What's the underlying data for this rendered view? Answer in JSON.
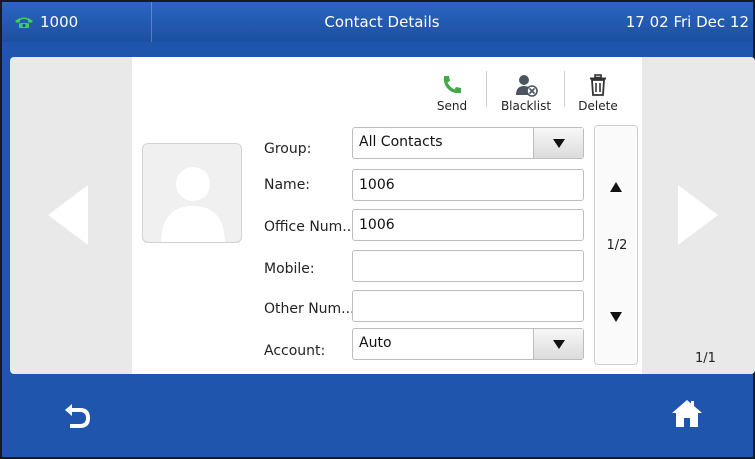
{
  "titlebar": {
    "line": "1000",
    "title": "Contact Details",
    "datetime": "17 02 Fri Dec 12"
  },
  "toolbar": {
    "send_label": "Send",
    "blacklist_label": "Blacklist",
    "delete_label": "Delete"
  },
  "form": {
    "group_label": "Group:",
    "group_value": "All Contacts",
    "name_label": "Name:",
    "name_value": "1006",
    "office_label": "Office Num...",
    "office_value": "1006",
    "mobile_label": "Mobile:",
    "mobile_value": "",
    "other_label": "Other Num...",
    "other_value": "",
    "account_label": "Account:",
    "account_value": "Auto"
  },
  "scroller": {
    "page": "1/2"
  },
  "page_count": "1/1",
  "icons": {
    "line": "phone-icon",
    "send": "handset-icon",
    "blacklist": "blocked-user-icon",
    "delete": "trash-icon",
    "back": "back-arrow-icon",
    "home": "home-icon"
  },
  "colors": {
    "titlebar": "#1f55ad",
    "send_icon": "#4caf50",
    "panel": "#e9e9e9"
  }
}
